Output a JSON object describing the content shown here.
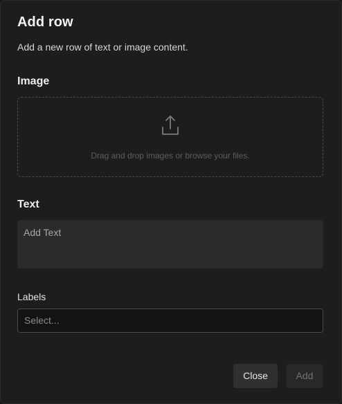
{
  "dialog": {
    "title": "Add row",
    "subtitle": "Add a new row of text or image content."
  },
  "image_section": {
    "label": "Image",
    "dropzone_text": "Drag and drop images or browse your files.",
    "icon": "upload-icon"
  },
  "text_section": {
    "label": "Text",
    "placeholder": "Add Text"
  },
  "labels_section": {
    "label": "Labels",
    "select_placeholder": "Select..."
  },
  "buttons": {
    "close_label": "Close",
    "add_label": "Add"
  },
  "colors": {
    "background": "#1c1d1d",
    "input_bg": "#2a2b2b",
    "select_bg": "#121313",
    "button_bg": "#2f3030",
    "disabled_text": "#727373"
  }
}
